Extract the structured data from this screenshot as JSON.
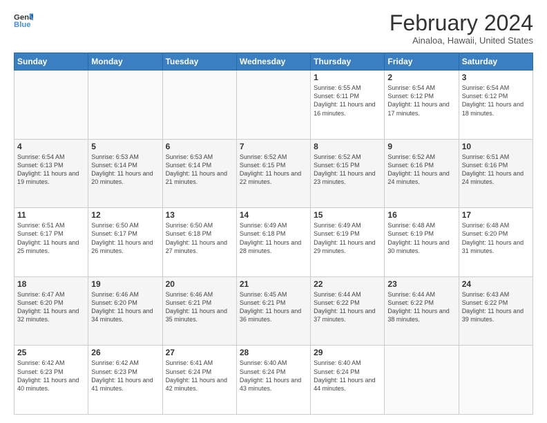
{
  "logo": {
    "line1": "General",
    "line2": "Blue"
  },
  "title": "February 2024",
  "subtitle": "Ainaloa, Hawaii, United States",
  "days_of_week": [
    "Sunday",
    "Monday",
    "Tuesday",
    "Wednesday",
    "Thursday",
    "Friday",
    "Saturday"
  ],
  "weeks": [
    [
      {
        "day": "",
        "info": ""
      },
      {
        "day": "",
        "info": ""
      },
      {
        "day": "",
        "info": ""
      },
      {
        "day": "",
        "info": ""
      },
      {
        "day": "1",
        "info": "Sunrise: 6:55 AM\nSunset: 6:11 PM\nDaylight: 11 hours and 16 minutes."
      },
      {
        "day": "2",
        "info": "Sunrise: 6:54 AM\nSunset: 6:12 PM\nDaylight: 11 hours and 17 minutes."
      },
      {
        "day": "3",
        "info": "Sunrise: 6:54 AM\nSunset: 6:12 PM\nDaylight: 11 hours and 18 minutes."
      }
    ],
    [
      {
        "day": "4",
        "info": "Sunrise: 6:54 AM\nSunset: 6:13 PM\nDaylight: 11 hours and 19 minutes."
      },
      {
        "day": "5",
        "info": "Sunrise: 6:53 AM\nSunset: 6:14 PM\nDaylight: 11 hours and 20 minutes."
      },
      {
        "day": "6",
        "info": "Sunrise: 6:53 AM\nSunset: 6:14 PM\nDaylight: 11 hours and 21 minutes."
      },
      {
        "day": "7",
        "info": "Sunrise: 6:52 AM\nSunset: 6:15 PM\nDaylight: 11 hours and 22 minutes."
      },
      {
        "day": "8",
        "info": "Sunrise: 6:52 AM\nSunset: 6:15 PM\nDaylight: 11 hours and 23 minutes."
      },
      {
        "day": "9",
        "info": "Sunrise: 6:52 AM\nSunset: 6:16 PM\nDaylight: 11 hours and 24 minutes."
      },
      {
        "day": "10",
        "info": "Sunrise: 6:51 AM\nSunset: 6:16 PM\nDaylight: 11 hours and 24 minutes."
      }
    ],
    [
      {
        "day": "11",
        "info": "Sunrise: 6:51 AM\nSunset: 6:17 PM\nDaylight: 11 hours and 25 minutes."
      },
      {
        "day": "12",
        "info": "Sunrise: 6:50 AM\nSunset: 6:17 PM\nDaylight: 11 hours and 26 minutes."
      },
      {
        "day": "13",
        "info": "Sunrise: 6:50 AM\nSunset: 6:18 PM\nDaylight: 11 hours and 27 minutes."
      },
      {
        "day": "14",
        "info": "Sunrise: 6:49 AM\nSunset: 6:18 PM\nDaylight: 11 hours and 28 minutes."
      },
      {
        "day": "15",
        "info": "Sunrise: 6:49 AM\nSunset: 6:19 PM\nDaylight: 11 hours and 29 minutes."
      },
      {
        "day": "16",
        "info": "Sunrise: 6:48 AM\nSunset: 6:19 PM\nDaylight: 11 hours and 30 minutes."
      },
      {
        "day": "17",
        "info": "Sunrise: 6:48 AM\nSunset: 6:20 PM\nDaylight: 11 hours and 31 minutes."
      }
    ],
    [
      {
        "day": "18",
        "info": "Sunrise: 6:47 AM\nSunset: 6:20 PM\nDaylight: 11 hours and 32 minutes."
      },
      {
        "day": "19",
        "info": "Sunrise: 6:46 AM\nSunset: 6:20 PM\nDaylight: 11 hours and 34 minutes."
      },
      {
        "day": "20",
        "info": "Sunrise: 6:46 AM\nSunset: 6:21 PM\nDaylight: 11 hours and 35 minutes."
      },
      {
        "day": "21",
        "info": "Sunrise: 6:45 AM\nSunset: 6:21 PM\nDaylight: 11 hours and 36 minutes."
      },
      {
        "day": "22",
        "info": "Sunrise: 6:44 AM\nSunset: 6:22 PM\nDaylight: 11 hours and 37 minutes."
      },
      {
        "day": "23",
        "info": "Sunrise: 6:44 AM\nSunset: 6:22 PM\nDaylight: 11 hours and 38 minutes."
      },
      {
        "day": "24",
        "info": "Sunrise: 6:43 AM\nSunset: 6:22 PM\nDaylight: 11 hours and 39 minutes."
      }
    ],
    [
      {
        "day": "25",
        "info": "Sunrise: 6:42 AM\nSunset: 6:23 PM\nDaylight: 11 hours and 40 minutes."
      },
      {
        "day": "26",
        "info": "Sunrise: 6:42 AM\nSunset: 6:23 PM\nDaylight: 11 hours and 41 minutes."
      },
      {
        "day": "27",
        "info": "Sunrise: 6:41 AM\nSunset: 6:24 PM\nDaylight: 11 hours and 42 minutes."
      },
      {
        "day": "28",
        "info": "Sunrise: 6:40 AM\nSunset: 6:24 PM\nDaylight: 11 hours and 43 minutes."
      },
      {
        "day": "29",
        "info": "Sunrise: 6:40 AM\nSunset: 6:24 PM\nDaylight: 11 hours and 44 minutes."
      },
      {
        "day": "",
        "info": ""
      },
      {
        "day": "",
        "info": ""
      }
    ]
  ]
}
